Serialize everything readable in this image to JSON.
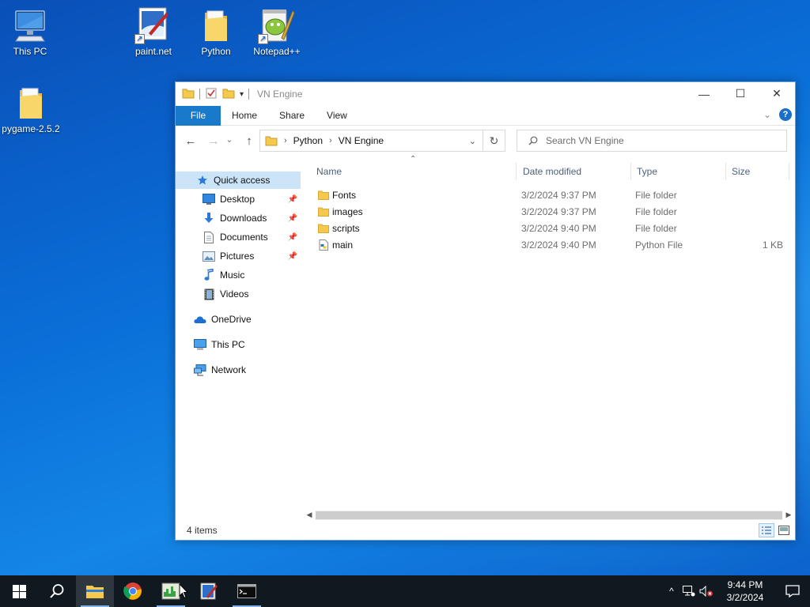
{
  "desktop": {
    "icons": [
      {
        "label": "This PC"
      },
      {
        "label": "paint.net"
      },
      {
        "label": "Python"
      },
      {
        "label": "Notepad++"
      },
      {
        "label": "pygame-2.5.2"
      }
    ]
  },
  "window": {
    "title": "VN Engine",
    "controls": {
      "minimize": "—",
      "maximize": "☐",
      "close": "✕"
    },
    "ribbon": {
      "file_tab": "File",
      "tabs": [
        "Home",
        "Share",
        "View"
      ],
      "expand_icon": "chevron-down-icon",
      "help_label": "?"
    },
    "navigation": {
      "back": "←",
      "forward": "→",
      "recent": "⌄",
      "up": "↑",
      "breadcrumb": [
        "Python",
        "VN Engine"
      ],
      "refresh": "↻",
      "search_placeholder": "Search VN Engine"
    },
    "nav_pane": {
      "quick_access": "Quick access",
      "pinned": [
        {
          "label": "Desktop",
          "pinned": true
        },
        {
          "label": "Downloads",
          "pinned": true
        },
        {
          "label": "Documents",
          "pinned": true
        },
        {
          "label": "Pictures",
          "pinned": true
        },
        {
          "label": "Music",
          "pinned": false
        },
        {
          "label": "Videos",
          "pinned": false
        }
      ],
      "onedrive": "OneDrive",
      "this_pc": "This PC",
      "network": "Network"
    },
    "columns": {
      "name": "Name",
      "date": "Date modified",
      "type": "Type",
      "size": "Size"
    },
    "files": [
      {
        "name": "Fonts",
        "date": "3/2/2024 9:37 PM",
        "type": "File folder",
        "size": "",
        "icon": "folder-icon"
      },
      {
        "name": "images",
        "date": "3/2/2024 9:37 PM",
        "type": "File folder",
        "size": "",
        "icon": "folder-icon"
      },
      {
        "name": "scripts",
        "date": "3/2/2024 9:40 PM",
        "type": "File folder",
        "size": "",
        "icon": "folder-icon"
      },
      {
        "name": "main",
        "date": "3/2/2024 9:40 PM",
        "type": "Python File",
        "size": "1 KB",
        "icon": "python-file-icon"
      }
    ],
    "status": "4 items"
  },
  "taskbar": {
    "apps": [
      "start-icon",
      "search-icon",
      "file-explorer-icon",
      "chrome-icon",
      "task-manager-icon",
      "paint-net-icon",
      "terminal-icon"
    ],
    "tray": {
      "time": "9:44 PM",
      "date": "3/2/2024"
    }
  },
  "colors": {
    "accent": "#1979ca",
    "selection": "#cce4f7",
    "folder": "#f4c94e",
    "taskbar": "#101820"
  }
}
